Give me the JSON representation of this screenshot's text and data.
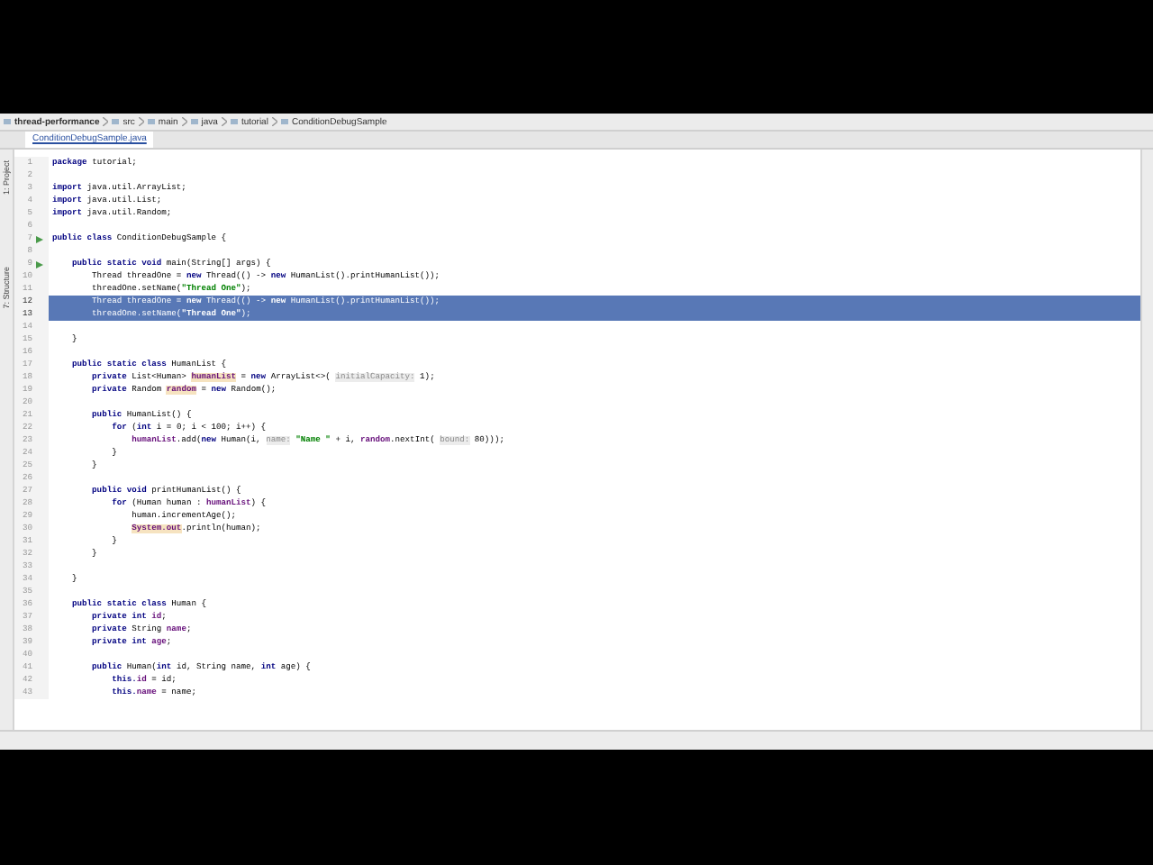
{
  "breadcrumbs": [
    {
      "label": "thread-performance"
    },
    {
      "label": "src"
    },
    {
      "label": "main"
    },
    {
      "label": "java"
    },
    {
      "label": "tutorial"
    },
    {
      "label": "ConditionDebugSample"
    }
  ],
  "tabs": [
    {
      "label": "ConditionDebugSample.java",
      "selected": true
    }
  ],
  "left_strip": [
    "1: Project",
    "7: Structure"
  ],
  "lines": [
    {
      "number": "1",
      "selected": false,
      "tokens": [
        {
          "kind": "kw",
          "text": "package"
        },
        {
          "kind": "plain",
          "text": " tutorial;"
        }
      ]
    },
    {
      "number": "2",
      "selected": false
    },
    {
      "number": "3",
      "selected": false,
      "tokens": [
        {
          "kind": "kw",
          "text": "import"
        },
        {
          "kind": "plain",
          "text": " java.util.ArrayList;"
        }
      ]
    },
    {
      "number": "4",
      "selected": false,
      "tokens": [
        {
          "kind": "kw",
          "text": "import"
        },
        {
          "kind": "plain",
          "text": " java.util.List;"
        }
      ]
    },
    {
      "number": "5",
      "selected": false,
      "tokens": [
        {
          "kind": "kw",
          "text": "import"
        },
        {
          "kind": "plain",
          "text": " java.util.Random;"
        }
      ]
    },
    {
      "number": "6",
      "selected": false
    },
    {
      "number": "7",
      "selected": false,
      "run": true,
      "tokens": [
        {
          "kind": "kw",
          "text": "public class"
        },
        {
          "kind": "plain",
          "text": " ConditionDebugSample {"
        }
      ]
    },
    {
      "number": "8",
      "selected": false
    },
    {
      "number": "9",
      "selected": false,
      "run": true,
      "tokens": [
        {
          "kind": "kw",
          "text": "    public static void"
        },
        {
          "kind": "plain",
          "text": " main(String[] args) {"
        }
      ]
    },
    {
      "number": "10",
      "selected": false,
      "tokens": [
        {
          "kind": "plain",
          "text": "        Thread threadOne = "
        },
        {
          "kind": "kw",
          "text": "new"
        },
        {
          "kind": "plain",
          "text": " Thread(() -> "
        },
        {
          "kind": "kw",
          "text": "new"
        },
        {
          "kind": "plain",
          "text": " HumanList().printHumanList());"
        }
      ]
    },
    {
      "number": "11",
      "selected": false,
      "tokens": [
        {
          "kind": "plain",
          "text": "        threadOne.setName("
        },
        {
          "kind": "str",
          "text": "\"Thread One\""
        },
        {
          "kind": "plain",
          "text": ");"
        }
      ]
    },
    {
      "number": "12",
      "selected": true,
      "tokens": [
        {
          "kind": "plain",
          "text": "        Thread threadOne = "
        },
        {
          "kind": "kw",
          "text": "new"
        },
        {
          "kind": "plain",
          "text": " Thread(() -> "
        },
        {
          "kind": "kw",
          "text": "new"
        },
        {
          "kind": "plain",
          "text": " HumanList().printHumanList());"
        }
      ]
    },
    {
      "number": "13",
      "selected": true,
      "tokens": [
        {
          "kind": "plain",
          "text": "        threadOne.setName("
        },
        {
          "kind": "str",
          "text": "\"Thread One\""
        },
        {
          "kind": "plain",
          "text": ");"
        }
      ]
    },
    {
      "number": "14",
      "selected": false
    },
    {
      "number": "15",
      "selected": false,
      "tokens": [
        {
          "kind": "plain",
          "text": "    }"
        }
      ]
    },
    {
      "number": "16",
      "selected": false
    },
    {
      "number": "17",
      "selected": false,
      "tokens": [
        {
          "kind": "kw",
          "text": "    public static class"
        },
        {
          "kind": "plain",
          "text": " HumanList {"
        }
      ]
    },
    {
      "number": "18",
      "selected": false,
      "tokens": [
        {
          "kind": "kw",
          "text": "        private"
        },
        {
          "kind": "plain",
          "text": " List<Human> "
        },
        {
          "kind": "usage",
          "text": "humanList"
        },
        {
          "kind": "plain",
          "text": " = "
        },
        {
          "kind": "kw",
          "text": "new"
        },
        {
          "kind": "plain",
          "text": " ArrayList<>( "
        },
        {
          "kind": "hint",
          "text": "initialCapacity:"
        },
        {
          "kind": "plain",
          "text": " 1);"
        }
      ]
    },
    {
      "number": "19",
      "selected": false,
      "tokens": [
        {
          "kind": "kw",
          "text": "        private"
        },
        {
          "kind": "plain",
          "text": " Random "
        },
        {
          "kind": "usage",
          "text": "random"
        },
        {
          "kind": "plain",
          "text": " = "
        },
        {
          "kind": "kw",
          "text": "new"
        },
        {
          "kind": "plain",
          "text": " Random();"
        }
      ]
    },
    {
      "number": "20",
      "selected": false
    },
    {
      "number": "21",
      "selected": false,
      "tokens": [
        {
          "kind": "kw",
          "text": "        public"
        },
        {
          "kind": "plain",
          "text": " HumanList() {"
        }
      ]
    },
    {
      "number": "22",
      "selected": false,
      "tokens": [
        {
          "kind": "kw",
          "text": "            for"
        },
        {
          "kind": "plain",
          "text": " ("
        },
        {
          "kind": "kw",
          "text": "int"
        },
        {
          "kind": "plain",
          "text": " i = 0; i < 100; i++) {"
        }
      ]
    },
    {
      "number": "23",
      "selected": false,
      "tokens": [
        {
          "kind": "field",
          "text": "                humanList"
        },
        {
          "kind": "plain",
          "text": ".add("
        },
        {
          "kind": "kw",
          "text": "new"
        },
        {
          "kind": "plain",
          "text": " Human(i, "
        },
        {
          "kind": "hint",
          "text": "name:"
        },
        {
          "kind": "str",
          "text": " \"Name \""
        },
        {
          "kind": "plain",
          "text": " + i, "
        },
        {
          "kind": "field",
          "text": "random"
        },
        {
          "kind": "plain",
          "text": ".nextInt( "
        },
        {
          "kind": "hint",
          "text": "bound:"
        },
        {
          "kind": "plain",
          "text": " 80)));"
        }
      ]
    },
    {
      "number": "24",
      "selected": false,
      "tokens": [
        {
          "kind": "plain",
          "text": "            }"
        }
      ]
    },
    {
      "number": "25",
      "selected": false,
      "tokens": [
        {
          "kind": "plain",
          "text": "        }"
        }
      ]
    },
    {
      "number": "26",
      "selected": false
    },
    {
      "number": "27",
      "selected": false,
      "tokens": [
        {
          "kind": "kw",
          "text": "        public void"
        },
        {
          "kind": "plain",
          "text": " printHumanList() {"
        }
      ]
    },
    {
      "number": "28",
      "selected": false,
      "tokens": [
        {
          "kind": "kw",
          "text": "            for"
        },
        {
          "kind": "plain",
          "text": " (Human human : "
        },
        {
          "kind": "field",
          "text": "humanList"
        },
        {
          "kind": "plain",
          "text": ") {"
        }
      ]
    },
    {
      "number": "29",
      "selected": false,
      "tokens": [
        {
          "kind": "plain",
          "text": "                human.incrementAge();"
        }
      ]
    },
    {
      "number": "30",
      "selected": false,
      "tokens": [
        {
          "kind": "usage",
          "text": "                System.out"
        },
        {
          "kind": "plain",
          "text": ".println(human);"
        }
      ]
    },
    {
      "number": "31",
      "selected": false,
      "tokens": [
        {
          "kind": "plain",
          "text": "            }"
        }
      ]
    },
    {
      "number": "32",
      "selected": false,
      "tokens": [
        {
          "kind": "plain",
          "text": "        }"
        }
      ]
    },
    {
      "number": "33",
      "selected": false
    },
    {
      "number": "34",
      "selected": false,
      "tokens": [
        {
          "kind": "plain",
          "text": "    }"
        }
      ]
    },
    {
      "number": "35",
      "selected": false
    },
    {
      "number": "36",
      "selected": false,
      "tokens": [
        {
          "kind": "kw",
          "text": "    public static class"
        },
        {
          "kind": "plain",
          "text": " Human {"
        }
      ]
    },
    {
      "number": "37",
      "selected": false,
      "tokens": [
        {
          "kind": "kw",
          "text": "        private int"
        },
        {
          "kind": "field",
          "text": " id"
        },
        {
          "kind": "plain",
          "text": ";"
        }
      ]
    },
    {
      "number": "38",
      "selected": false,
      "tokens": [
        {
          "kind": "kw",
          "text": "        private"
        },
        {
          "kind": "plain",
          "text": " String "
        },
        {
          "kind": "field",
          "text": "name"
        },
        {
          "kind": "plain",
          "text": ";"
        }
      ]
    },
    {
      "number": "39",
      "selected": false,
      "tokens": [
        {
          "kind": "kw",
          "text": "        private int"
        },
        {
          "kind": "field",
          "text": " age"
        },
        {
          "kind": "plain",
          "text": ";"
        }
      ]
    },
    {
      "number": "40",
      "selected": false
    },
    {
      "number": "41",
      "selected": false,
      "tokens": [
        {
          "kind": "kw",
          "text": "        public"
        },
        {
          "kind": "plain",
          "text": " Human("
        },
        {
          "kind": "kw",
          "text": "int"
        },
        {
          "kind": "plain",
          "text": " id, String name, "
        },
        {
          "kind": "kw",
          "text": "int"
        },
        {
          "kind": "plain",
          "text": " age) {"
        }
      ]
    },
    {
      "number": "42",
      "selected": false,
      "tokens": [
        {
          "kind": "kw",
          "text": "            this."
        },
        {
          "kind": "field",
          "text": "id"
        },
        {
          "kind": "plain",
          "text": " = id;"
        }
      ]
    },
    {
      "number": "43",
      "selected": false,
      "tokens": [
        {
          "kind": "kw",
          "text": "            this."
        },
        {
          "kind": "field",
          "text": "name"
        },
        {
          "kind": "plain",
          "text": " = name;"
        }
      ]
    }
  ]
}
